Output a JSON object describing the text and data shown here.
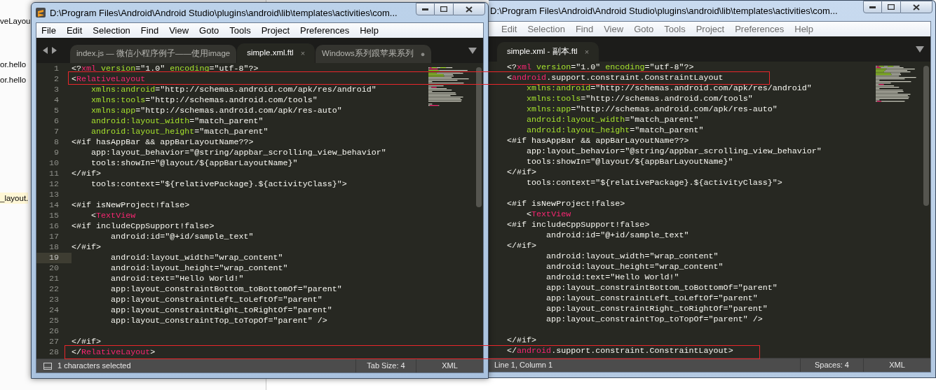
{
  "background_app": {
    "fragments": [
      {
        "text": "veLayou",
        "highlighted": false
      },
      {
        "text": "or.hello",
        "highlighted": false
      },
      {
        "text": "or.hello",
        "highlighted": false
      },
      {
        "text": "_layout.",
        "highlighted": true
      }
    ]
  },
  "windows": [
    {
      "title": "D:\\Program Files\\Android\\Android Studio\\plugins\\android\\lib\\templates\\activities\\com...",
      "menu": [
        "File",
        "Edit",
        "Selection",
        "Find",
        "View",
        "Goto",
        "Tools",
        "Project",
        "Preferences",
        "Help"
      ],
      "tabs": [
        {
          "label": "index.js — 微信小程序例子——使用image",
          "selected": false
        },
        {
          "label": "simple.xml.ftl",
          "selected": true,
          "marker": "×"
        },
        {
          "label": "Windows系列跟苹果系列",
          "selected": false,
          "marker": "●"
        }
      ],
      "lines": [
        {
          "number": "1",
          "segments": [
            {
              "kind": "plain",
              "text": "<?"
            },
            {
              "kind": "tag",
              "text": "xml"
            },
            {
              "kind": "attr",
              "text": " version"
            },
            {
              "kind": "plain",
              "text": "=\"1.0\""
            },
            {
              "kind": "attr",
              "text": " encoding"
            },
            {
              "kind": "plain",
              "text": "=\"utf-8\"?>"
            }
          ]
        },
        {
          "number": "2",
          "segments": [
            {
              "kind": "plain",
              "text": "<"
            },
            {
              "kind": "tag",
              "text": "RelativeLayout"
            }
          ]
        },
        {
          "number": "3",
          "segments": [
            {
              "kind": "attr",
              "text": "    xmlns:android"
            },
            {
              "kind": "plain",
              "text": "=\"http://schemas.android.com/apk/res/android\""
            }
          ]
        },
        {
          "number": "4",
          "segments": [
            {
              "kind": "attr",
              "text": "    xmlns:tools"
            },
            {
              "kind": "plain",
              "text": "=\"http://schemas.android.com/tools\""
            }
          ]
        },
        {
          "number": "5",
          "segments": [
            {
              "kind": "attr",
              "text": "    xmlns:app"
            },
            {
              "kind": "plain",
              "text": "=\"http://schemas.android.com/apk/res-auto\""
            }
          ]
        },
        {
          "number": "6",
          "segments": [
            {
              "kind": "attr",
              "text": "    android:layout_width"
            },
            {
              "kind": "plain",
              "text": "=\"match_parent\""
            }
          ]
        },
        {
          "number": "7",
          "segments": [
            {
              "kind": "attr",
              "text": "    android:layout_height"
            },
            {
              "kind": "plain",
              "text": "=\"match_parent\""
            }
          ]
        },
        {
          "number": "8",
          "segments": [
            {
              "kind": "plain",
              "text": "<#if hasAppBar && appBarLayoutName??>"
            }
          ]
        },
        {
          "number": "9",
          "segments": [
            {
              "kind": "plain",
              "text": "    app:layout_behavior=\"@string/appbar_scrolling_view_behavior\""
            }
          ]
        },
        {
          "number": "10",
          "segments": [
            {
              "kind": "plain",
              "text": "    tools:showIn=\"@layout/${appBarLayoutName}\""
            }
          ]
        },
        {
          "number": "11",
          "segments": [
            {
              "kind": "plain",
              "text": "</#if>"
            }
          ]
        },
        {
          "number": "12",
          "segments": [
            {
              "kind": "plain",
              "text": "    tools:context=\"${relativePackage}.${activityClass}\">"
            }
          ]
        },
        {
          "number": "13"
        },
        {
          "number": "14",
          "segments": [
            {
              "kind": "plain",
              "text": "<#if isNewProject!false>"
            }
          ]
        },
        {
          "number": "15",
          "segments": [
            {
              "kind": "plain",
              "text": "    <"
            },
            {
              "kind": "tag",
              "text": "TextView"
            }
          ]
        },
        {
          "number": "16",
          "segments": [
            {
              "kind": "plain",
              "text": "<#if includeCppSupport!false>"
            }
          ]
        },
        {
          "number": "17",
          "segments": [
            {
              "kind": "plain",
              "text": "        android:id=\"@+id/sample_text\""
            }
          ]
        },
        {
          "number": "18",
          "segments": [
            {
              "kind": "plain",
              "text": "</#if>"
            }
          ]
        },
        {
          "number": "19",
          "current": true,
          "segments": [
            {
              "kind": "plain",
              "text": "        android:layout_width=\"wrap_content\""
            }
          ]
        },
        {
          "number": "20",
          "segments": [
            {
              "kind": "plain",
              "text": "        android:layout_height=\"wrap_content\""
            }
          ]
        },
        {
          "number": "21",
          "segments": [
            {
              "kind": "plain",
              "text": "        android:text=\"Hello World!\""
            }
          ]
        },
        {
          "number": "22",
          "segments": [
            {
              "kind": "plain",
              "text": "        app:layout_constraintBottom_toBottomOf=\"parent\""
            }
          ]
        },
        {
          "number": "23",
          "segments": [
            {
              "kind": "plain",
              "text": "        app:layout_constraintLeft_toLeftOf=\"parent\""
            }
          ]
        },
        {
          "number": "24",
          "segments": [
            {
              "kind": "plain",
              "text": "        app:layout_constraintRight_toRightOf=\"parent\""
            }
          ]
        },
        {
          "number": "25",
          "segments": [
            {
              "kind": "plain",
              "text": "        app:layout_constraintTop_toTopOf=\"parent\" />"
            }
          ]
        },
        {
          "number": "26"
        },
        {
          "number": "27",
          "segments": [
            {
              "kind": "plain",
              "text": "</#if>"
            }
          ]
        },
        {
          "number": "28",
          "segments": [
            {
              "kind": "plain",
              "text": "</"
            },
            {
              "kind": "tag",
              "text": "RelativeLayout"
            },
            {
              "kind": "plain",
              "text": ">"
            }
          ]
        }
      ],
      "status": {
        "message": "1 characters selected",
        "indent": "Tab Size: 4",
        "syntax": "XML"
      }
    },
    {
      "title": "D:\\Program Files\\Android\\Android Studio\\plugins\\android\\lib\\templates\\activities\\com...",
      "menu": [
        "Edit",
        "Selection",
        "Find",
        "View",
        "Goto",
        "Tools",
        "Project",
        "Preferences",
        "Help"
      ],
      "tabs": [
        {
          "label": "simple.xml - 副本.ftl",
          "selected": true,
          "marker": "×"
        }
      ],
      "lines": [
        {
          "segments": [
            {
              "kind": "plain",
              "text": "<?"
            },
            {
              "kind": "tag",
              "text": "xml"
            },
            {
              "kind": "attr",
              "text": " version"
            },
            {
              "kind": "plain",
              "text": "=\"1.0\""
            },
            {
              "kind": "attr",
              "text": " encoding"
            },
            {
              "kind": "plain",
              "text": "=\"utf-8\"?>"
            }
          ]
        },
        {
          "segments": [
            {
              "kind": "plain",
              "text": "<"
            },
            {
              "kind": "tag",
              "text": "android"
            },
            {
              "kind": "plain",
              "text": ".support.constraint.ConstraintLayout"
            }
          ]
        },
        {
          "segments": [
            {
              "kind": "attr",
              "text": "    xmlns:android"
            },
            {
              "kind": "plain",
              "text": "=\"http://schemas.android.com/apk/res/android\""
            }
          ]
        },
        {
          "segments": [
            {
              "kind": "attr",
              "text": "    xmlns:tools"
            },
            {
              "kind": "plain",
              "text": "=\"http://schemas.android.com/tools\""
            }
          ]
        },
        {
          "segments": [
            {
              "kind": "attr",
              "text": "    xmlns:app"
            },
            {
              "kind": "plain",
              "text": "=\"http://schemas.android.com/apk/res-auto\""
            }
          ]
        },
        {
          "segments": [
            {
              "kind": "attr",
              "text": "    android:layout_width"
            },
            {
              "kind": "plain",
              "text": "=\"match_parent\""
            }
          ]
        },
        {
          "segments": [
            {
              "kind": "attr",
              "text": "    android:layout_height"
            },
            {
              "kind": "plain",
              "text": "=\"match_parent\""
            }
          ]
        },
        {
          "segments": [
            {
              "kind": "plain",
              "text": "<#if hasAppBar && appBarLayoutName??>"
            }
          ]
        },
        {
          "segments": [
            {
              "kind": "plain",
              "text": "    app:layout_behavior=\"@string/appbar_scrolling_view_behavior\""
            }
          ]
        },
        {
          "segments": [
            {
              "kind": "plain",
              "text": "    tools:showIn=\"@layout/${appBarLayoutName}\""
            }
          ]
        },
        {
          "segments": [
            {
              "kind": "plain",
              "text": "</#if>"
            }
          ]
        },
        {
          "segments": [
            {
              "kind": "plain",
              "text": "    tools:context=\"${relativePackage}.${activityClass}\">"
            }
          ]
        },
        {
          "gap_before": true,
          "segments": [
            {
              "kind": "plain",
              "text": "<#if isNewProject!false>"
            }
          ]
        },
        {
          "segments": [
            {
              "kind": "plain",
              "text": "    <"
            },
            {
              "kind": "tag",
              "text": "TextView"
            }
          ]
        },
        {
          "segments": [
            {
              "kind": "plain",
              "text": "<#if includeCppSupport!false>"
            }
          ]
        },
        {
          "segments": [
            {
              "kind": "plain",
              "text": "        android:id=\"@+id/sample_text\""
            }
          ]
        },
        {
          "segments": [
            {
              "kind": "plain",
              "text": "</#if>"
            }
          ]
        },
        {
          "segments": [
            {
              "kind": "plain",
              "text": "        android:layout_width=\"wrap_content\""
            }
          ]
        },
        {
          "segments": [
            {
              "kind": "plain",
              "text": "        android:layout_height=\"wrap_content\""
            }
          ]
        },
        {
          "segments": [
            {
              "kind": "plain",
              "text": "        android:text=\"Hello World!\""
            }
          ]
        },
        {
          "segments": [
            {
              "kind": "plain",
              "text": "        app:layout_constraintBottom_toBottomOf=\"parent\""
            }
          ]
        },
        {
          "segments": [
            {
              "kind": "plain",
              "text": "        app:layout_constraintLeft_toLeftOf=\"parent\""
            }
          ]
        },
        {
          "segments": [
            {
              "kind": "plain",
              "text": "        app:layout_constraintRight_toRightOf=\"parent\""
            }
          ]
        },
        {
          "segments": [
            {
              "kind": "plain",
              "text": "        app:layout_constraintTop_toTopOf=\"parent\" />"
            }
          ]
        },
        {
          "gap_before": true,
          "segments": [
            {
              "kind": "plain",
              "text": "</#if>"
            }
          ]
        },
        {
          "segments": [
            {
              "kind": "plain",
              "text": "</"
            },
            {
              "kind": "tag",
              "text": "android"
            },
            {
              "kind": "plain",
              "text": ".support.constraint.ConstraintLayout>"
            }
          ]
        }
      ],
      "status": {
        "message": "Line 1, Column 1",
        "indent": "Spaces: 4",
        "syntax": "XML"
      }
    }
  ]
}
